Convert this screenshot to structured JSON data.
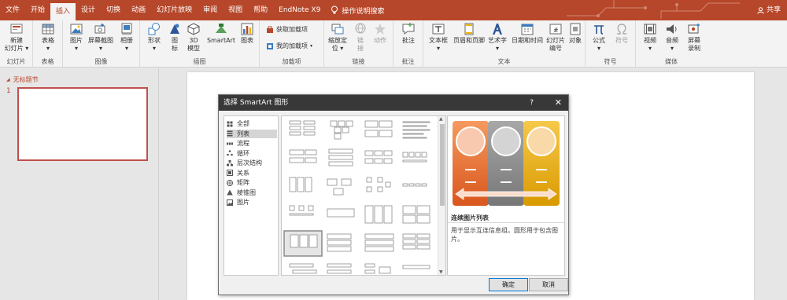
{
  "tabs": [
    {
      "label": "文件",
      "active": false
    },
    {
      "label": "开始",
      "active": false
    },
    {
      "label": "插入",
      "active": true
    },
    {
      "label": "设计",
      "active": false
    },
    {
      "label": "切换",
      "active": false
    },
    {
      "label": "动画",
      "active": false
    },
    {
      "label": "幻灯片放映",
      "active": false
    },
    {
      "label": "审阅",
      "active": false
    },
    {
      "label": "视图",
      "active": false
    },
    {
      "label": "帮助",
      "active": false
    },
    {
      "label": "EndNote X9",
      "active": false
    }
  ],
  "tell_me": "操作说明搜索",
  "share": "共享",
  "ribbon": {
    "groups": {
      "slides": "幻灯片",
      "tables": "表格",
      "images": "图像",
      "illustrations": "插图",
      "addins": "加载项",
      "links": "链接",
      "comments": "批注",
      "text": "文本",
      "symbols": "符号",
      "media": "媒体"
    },
    "buttons": {
      "new_slide": "新建\n幻灯片 ▾",
      "table": "表格\n▾",
      "pictures": "图片\n▾",
      "screenshot": "屏幕截图\n▾",
      "album": "相册\n▾",
      "shapes": "形状\n▾",
      "icons": "图\n标",
      "models": "3D\n模型",
      "smartart": "SmartArt",
      "chart": "图表",
      "get_addins": "获取加载项",
      "my_addins": "我的加载项",
      "zoom": "缩放定\n位 ▾",
      "link": "链\n接",
      "action": "动作",
      "comment": "批注",
      "textbox": "文本框\n▾",
      "header_footer": "页眉和页脚",
      "wordart": "艺术字\n▾",
      "datetime": "日期和时间",
      "slide_number": "幻灯片\n编号",
      "object": "对象",
      "equation": "公式\n▾",
      "symbol": "符号",
      "video": "视频\n▾",
      "audio": "音频\n▾",
      "screen_rec": "屏幕\n录制"
    }
  },
  "slides_pane": {
    "section": "无标题节",
    "slide_number": "1"
  },
  "dialog": {
    "title": "选择 SmartArt 图形",
    "help": "?",
    "close": "✕",
    "categories": [
      {
        "label": "全部",
        "icon": "all-icon",
        "selected": false
      },
      {
        "label": "列表",
        "icon": "list-icon",
        "selected": true
      },
      {
        "label": "流程",
        "icon": "process-icon",
        "selected": false
      },
      {
        "label": "循环",
        "icon": "cycle-icon",
        "selected": false
      },
      {
        "label": "层次结构",
        "icon": "hierarchy-icon",
        "selected": false
      },
      {
        "label": "关系",
        "icon": "relationship-icon",
        "selected": false
      },
      {
        "label": "矩阵",
        "icon": "matrix-icon",
        "selected": false
      },
      {
        "label": "棱锥图",
        "icon": "pyramid-icon",
        "selected": false
      },
      {
        "label": "图片",
        "icon": "picture-icon",
        "selected": false
      }
    ],
    "selected_layout_index": 16,
    "preview": {
      "name": "连续图片列表",
      "description": "用于显示互连信息组。圆形用于包含图片。",
      "colors": [
        "#f07a3e",
        "#8f8f8f",
        "#f2b31c"
      ]
    },
    "ok": "确定",
    "cancel": "取消"
  },
  "colors": {
    "accent": "#b7472a",
    "ribbon_bg": "#f3f3f3",
    "dialog_title": "#383838"
  }
}
